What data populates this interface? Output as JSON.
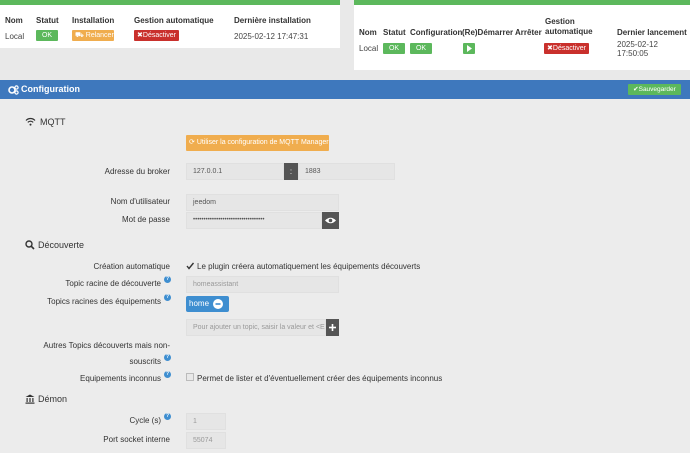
{
  "left_table": {
    "headers": [
      "Nom",
      "Statut",
      "Installation",
      "Gestion automatique",
      "Dernière installation"
    ],
    "row": {
      "name": "Local",
      "status": "OK",
      "install_button": "Relancer",
      "auto_button": "Désactiver",
      "last_install": "2025-02-12 17:47:31"
    }
  },
  "right_table": {
    "headers": [
      "Nom",
      "Statut",
      "Configuration",
      "(Re)Démarrer",
      "Arrêter",
      "Gestion",
      "automatique",
      "Dernier lancement"
    ],
    "row": {
      "name": "Local",
      "status": "OK",
      "config": "OK",
      "auto_button": "Désactiver",
      "last_launch_date": "2025-02-12",
      "last_launch_time": "17:50:05"
    }
  },
  "config_header": {
    "title": "Configuration",
    "save_label": "Sauvegarder"
  },
  "mqtt": {
    "title": "MQTT",
    "use_manager_button": "Utiliser la configuration de MQTT Manager",
    "broker_label": "Adresse du broker",
    "broker_host": "127.0.0.1",
    "broker_sep": ":",
    "broker_port": "1883",
    "user_label": "Nom d'utilisateur",
    "user_value": "jeedom",
    "password_label": "Mot de passe",
    "password_value": "••••••••••••••••••••••••••••••••••"
  },
  "discovery": {
    "title": "Découverte",
    "auto_create_label": "Création automatique",
    "auto_create_text": "Le plugin créera automatiquement les équipements découverts",
    "root_topic_label": "Topic racine de découverte",
    "root_topic_value": "homeassistant",
    "root_topics_label": "Topics racines des équipements",
    "root_topic_tag": "home",
    "add_topic_placeholder": "Pour ajouter un topic, saisir la valeur et <Ent",
    "other_topics_label_1": "Autres Topics découverts mais non-",
    "other_topics_label_2": "souscrits",
    "unknown_label": "Equipements inconnus",
    "unknown_text": "Permet de lister et d'éventuellement créer des équipements inconnus"
  },
  "daemon": {
    "title": "Démon",
    "cycle_label": "Cycle (s)",
    "cycle_value": "1",
    "port_label": "Port socket interne",
    "port_value": "55074"
  }
}
